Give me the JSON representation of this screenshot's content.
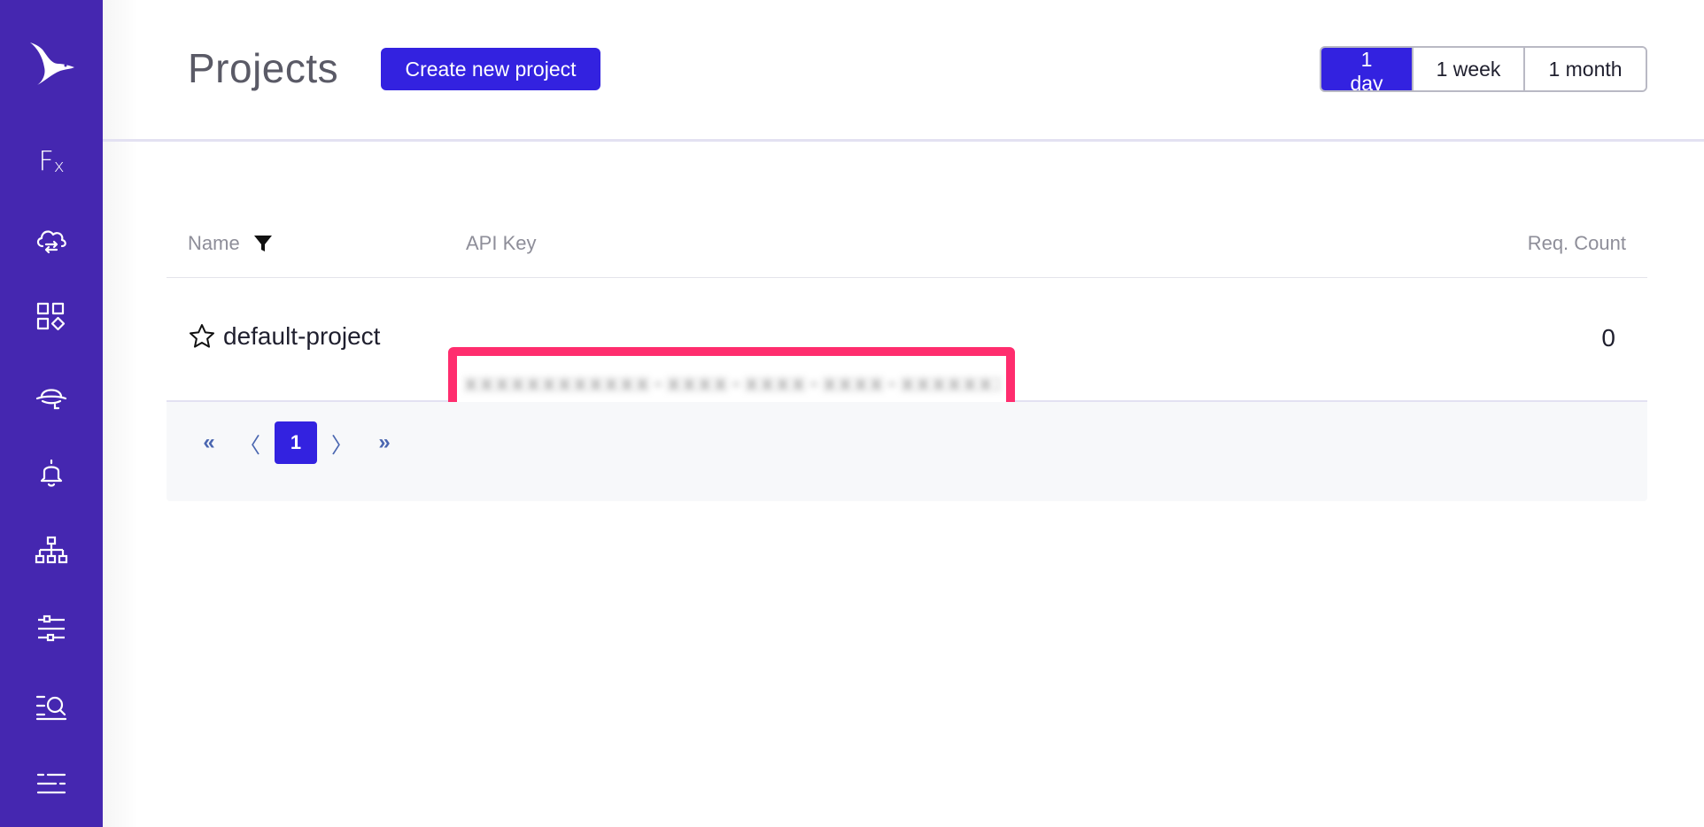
{
  "sidebar": {
    "logo": "bird-logo",
    "items": [
      {
        "name": "functions",
        "icon": "fx-icon",
        "label": "F",
        "sub": "x"
      },
      {
        "name": "cloud-sync",
        "icon": "cloud-sync-icon"
      },
      {
        "name": "dashboard",
        "icon": "grid-shapes-icon"
      },
      {
        "name": "incognito",
        "icon": "hat-icon"
      },
      {
        "name": "alerts",
        "icon": "bell-icon"
      },
      {
        "name": "hierarchy",
        "icon": "sitemap-icon"
      },
      {
        "name": "settings",
        "icon": "sliders-icon"
      },
      {
        "name": "logs",
        "icon": "list-search-icon"
      },
      {
        "name": "menu",
        "icon": "menu-lines-icon"
      }
    ],
    "color": "#4527b0"
  },
  "header": {
    "title": "Projects",
    "create_label": "Create new project",
    "ranges": [
      {
        "label": "1 day",
        "active": true
      },
      {
        "label": "1 week",
        "active": false
      },
      {
        "label": "1 month",
        "active": false
      }
    ]
  },
  "table": {
    "columns": {
      "name": "Name",
      "api_key": "API Key",
      "count": "Req. Count"
    },
    "rows": [
      {
        "name": "default-project",
        "api_key": "xxxxxxxxxxxx-xxxx-xxxx-xxxx-xxxxxxxxxxxx",
        "count": "0",
        "starred": false
      }
    ]
  },
  "pagination": {
    "first": "«",
    "prev": "〈",
    "current": "1",
    "next": "〉",
    "last": "»"
  },
  "colors": {
    "accent": "#3322e0",
    "highlight": "#ff2d6e"
  }
}
